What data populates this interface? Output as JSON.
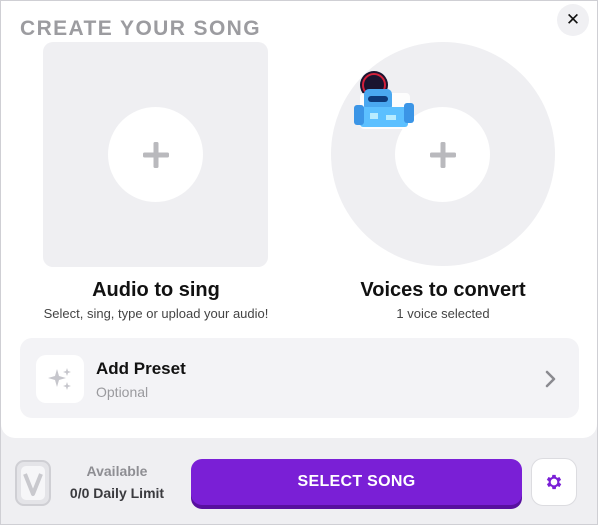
{
  "dialog": {
    "title": "CREATE YOUR SONG",
    "close_icon": "close-icon",
    "close_glyph": "✕"
  },
  "audio": {
    "label": "Audio to sing",
    "sub": "Select, sing, type or upload your audio!",
    "icon": "plus-icon"
  },
  "voices": {
    "label": "Voices to convert",
    "sub": "1 voice selected",
    "icon": "plus-icon",
    "selected_count": 1
  },
  "preset": {
    "title": "Add Preset",
    "sub": "Optional",
    "icon": "sparkles-icon",
    "chevron_icon": "chevron-right-icon"
  },
  "footer": {
    "available_label": "Available",
    "limit_label": "0/0 Daily Limit",
    "select_button": "SELECT SONG",
    "gear_icon": "gear-icon"
  },
  "colors": {
    "accent": "#7a1fd6",
    "tile_bg": "#efeff2",
    "title_gray": "#9c9ca0"
  }
}
